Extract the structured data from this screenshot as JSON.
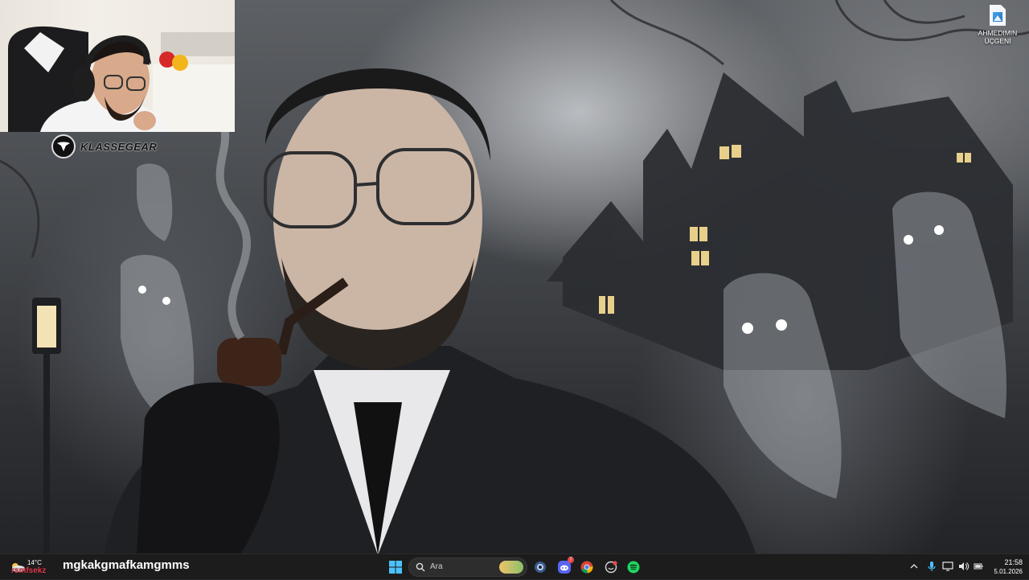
{
  "desktop": {
    "icons": [
      {
        "label_line1": "AHMEDIMIN",
        "label_line2": "ÜÇGENİ",
        "icon": "image-file-icon"
      }
    ]
  },
  "webcam": {
    "brand": "KLASSEGEAR"
  },
  "overlay": {
    "caption": "mgkakgmafkamgmms"
  },
  "taskbar": {
    "weather": {
      "temp": "14°C",
      "condition": "rsmfsekz"
    },
    "search_placeholder": "Ara",
    "apps": [
      {
        "name": "start",
        "icon": "windows-start-icon"
      },
      {
        "name": "search",
        "icon": "search-icon"
      },
      {
        "name": "widgets-pill",
        "icon": "search-highlight-icon"
      },
      {
        "name": "app-1",
        "icon": "dark-orb-app-icon"
      },
      {
        "name": "discord",
        "icon": "discord-icon",
        "badge": "7"
      },
      {
        "name": "chrome",
        "icon": "chrome-icon"
      },
      {
        "name": "app-2",
        "icon": "circle-app-icon"
      },
      {
        "name": "spotify",
        "icon": "spotify-icon"
      }
    ],
    "tray": {
      "icons": [
        "chevron-up-icon",
        "microphone-icon",
        "display-icon",
        "volume-icon",
        "battery-icon"
      ],
      "time": "21:58",
      "date": "5.01.2026"
    }
  },
  "colors": {
    "taskbar_bg": "#1c1c1c",
    "accent_blue": "#4cc2ff",
    "spotify_green": "#1ed760",
    "discord_blurple": "#5865f2",
    "notification_red": "#e5484d"
  }
}
